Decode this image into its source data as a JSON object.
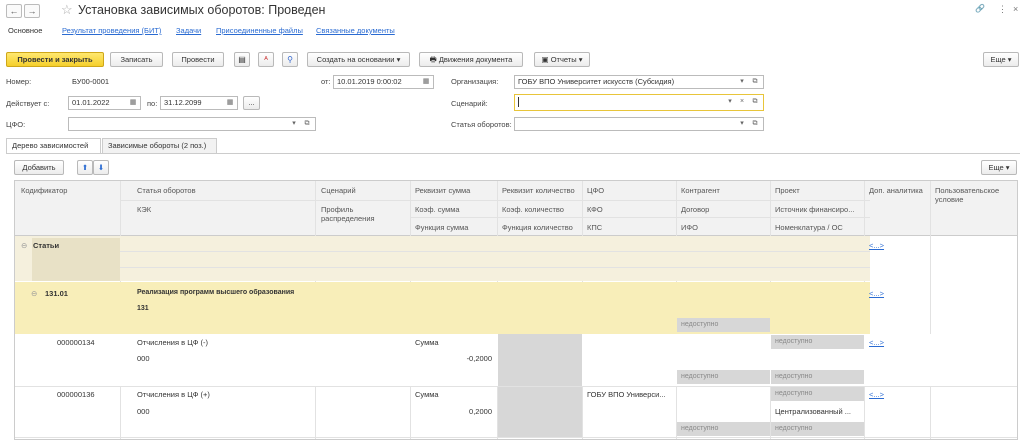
{
  "header": {
    "back": "←",
    "forward": "→",
    "star": "☆",
    "title": "Установка зависимых оборотов: Проведен",
    "link_icon": "🔗",
    "menu_icon": "⋮",
    "close_icon": "×"
  },
  "tabs": [
    "Основное",
    "Результат проведения (БИТ)",
    "Задачи",
    "Присоединенные файлы",
    "Связанные документы"
  ],
  "toolbar": {
    "post_close": "Провести и закрыть",
    "save": "Записать",
    "post": "Провести",
    "create_based": "Создать на основании",
    "movements": "Движения документа",
    "reports": "Отчеты",
    "more": "Еще"
  },
  "form": {
    "number_label": "Номер:",
    "number_value": "БУ00-0001",
    "from_label": "от:",
    "from_value": "10.01.2019 0:00:02",
    "org_label": "Организация:",
    "org_value": "ГОБУ ВПО Университет искусств (Субсидия)",
    "valid_from_label": "Действует с:",
    "valid_from_value": "01.01.2022",
    "to_label": "по:",
    "to_value": "31.12.2099",
    "ellipsis": "...",
    "scenario_label": "Сценарий:",
    "scenario_value": "",
    "cfo_label": "ЦФО:",
    "cfo_value": "",
    "article_label": "Статья оборотов:",
    "article_value": ""
  },
  "page_tabs": [
    "Дерево зависимостей",
    "Зависимые обороты (2 поз.)"
  ],
  "grid_toolbar": {
    "add": "Добавить",
    "up": "⬆",
    "down": "⬇",
    "more": "Еще"
  },
  "columns": {
    "r1": [
      "Кодификатор",
      "Статья оборотов",
      "Сценарий",
      "Реквизит сумма",
      "Реквизит количество",
      "ЦФО",
      "Контрагент",
      "Проект",
      "Доп. аналитика",
      "Пользовательское условие"
    ],
    "r2": [
      "КЭК",
      "Профиль распределения",
      "Коэф. сумма",
      "Коэф. количество",
      "КФО",
      "Договор",
      "Источник финансиро..."
    ],
    "r3": [
      "Функция сумма",
      "Функция количество",
      "КПС",
      "ИФО",
      "Номенклатура / ОС"
    ]
  },
  "rows": {
    "group1": {
      "label": "Статьи",
      "link": "<...>"
    },
    "group2": {
      "code": "131.01",
      "name": "Реализация программ высшего образования",
      "kek": "131",
      "na": "недоступно",
      "link": "<...>"
    },
    "row1": {
      "code": "000000134",
      "article": "Отчисления в ЦФ (-)",
      "kek": "000",
      "sum_attr": "Сумма",
      "coef": "-0,2000",
      "na1": "недоступно",
      "na2": "недоступно",
      "na3": "недоступно",
      "link": "<...>"
    },
    "row2": {
      "code": "000000136",
      "article": "Отчисления в ЦФ (+)",
      "kek": "000",
      "sum_attr": "Сумма",
      "coef": "0,2000",
      "cfo": "ГОБУ ВПО Универси...",
      "na1": "недоступно",
      "source": "Централизованный ...",
      "na2": "недоступно",
      "na3": "недоступно",
      "link": "<...>"
    }
  }
}
